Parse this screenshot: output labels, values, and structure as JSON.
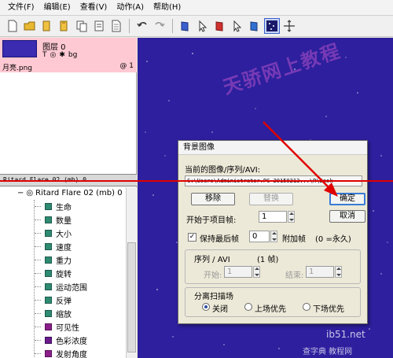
{
  "menu": [
    "文件(F)",
    "编辑(E)",
    "查看(V)",
    "动作(A)",
    "帮助(H)"
  ],
  "layer": {
    "name": "图层 0",
    "file": "月亮.png",
    "count": "@ 1",
    "badge": "bg"
  },
  "emitter_bar": "Ritard Flare 02 (mb) 0",
  "tree": {
    "root": "Ritard Flare 02 (mb) 0",
    "items": [
      "生命",
      "数量",
      "大小",
      "速度",
      "重力",
      "旋转",
      "运动范围",
      "反弹",
      "缩放",
      "可见性",
      "色彩浓度",
      "发射角度"
    ]
  },
  "watermark": "天骄网上教程",
  "dialog": {
    "title": "背景图像",
    "path_label": "当前的图像/序列/AVI:",
    "path_value": "C:\\Users\\Administrator.PC-20150213...\\R\\Desk",
    "remove": "移除",
    "replace": "替换",
    "ok": "确定",
    "cancel": "取消",
    "start_frame_label": "开始于项目帧:",
    "start_frame_value": "1",
    "hold_last_label": "保持最后帧",
    "hold_value": "0",
    "extra_label": "附加帧",
    "forever_label": "(0 =永久)",
    "seq_label": "序列 / AVI",
    "seq_frames": "(1 帧)",
    "start_label": "开始:",
    "start_value": "1",
    "end_label": "结束:",
    "end_value": "1",
    "field_label": "分离扫描场",
    "radio_off": "关闭",
    "radio_upper": "上场优先",
    "radio_lower": "下场优先"
  },
  "footer": {
    "site": "ib51.net",
    "brand": "查字典 教程网"
  }
}
